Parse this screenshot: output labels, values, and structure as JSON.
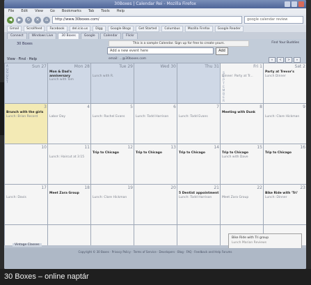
{
  "window": {
    "title": "30Boxes | Calendar Rei - Mozilla Firefox"
  },
  "menubar": [
    "File",
    "Edit",
    "View",
    "Go",
    "Bookmarks",
    "Tab",
    "Tools",
    "Help"
  ],
  "navbar": {
    "url": "http://www.30boxes.com/",
    "search_placeholder": "google calendar review"
  },
  "bookmarks": [
    "Gmail",
    "Scrollfeed",
    "Facebook",
    "del.icio.us",
    "Digg",
    "Google Blogs",
    "Get Started",
    "Columbus",
    "Mozilla Firefox",
    "Google Reader"
  ],
  "tabs": [
    "Connect",
    "Windows Live",
    "30 Boxes",
    "Google",
    "Calendar",
    "Flickr"
  ],
  "app": {
    "brand": "30 Boxes",
    "notice": "This is a sample Calendar. Sign up for free to create yours.",
    "top_links": "Find Your Buddies",
    "add_placeholder": "Add a new event here",
    "add_button": "Add",
    "view_menus": "View · Find · Help",
    "email_line": "email: ...@30boxes.com",
    "nav_arrows": [
      "«",
      "<",
      ">",
      "»"
    ]
  },
  "calendar": {
    "month_label": "SEPTEMBER",
    "sidebar_label": "AUGUST",
    "rows": [
      [
        {
          "day": "Sun 27",
          "ev": "",
          "sub": "",
          "type": "prev"
        },
        {
          "day": "Mon 28",
          "ev": "Mon & Dad's anniversary",
          "sub": "Lunch with Tom",
          "type": "prev"
        },
        {
          "day": "Tue 29",
          "ev": "",
          "sub": "Lunch with R.",
          "type": "prev"
        },
        {
          "day": "Wed 30",
          "ev": "",
          "sub": "",
          "type": "prev"
        },
        {
          "day": "Thu 31",
          "ev": "",
          "sub": "",
          "type": "prev"
        },
        {
          "day": "Fri 1",
          "ev": "",
          "sub": "Dinner: Party at Tr...",
          "type": "cur"
        },
        {
          "day": "Sat 2",
          "ev": "Party at Trevor's",
          "sub": "Lunch Dinner",
          "type": "cur"
        }
      ],
      [
        {
          "day": "3",
          "ev": "Brunch with the girls",
          "sub": "Lunch: Brian Record",
          "type": "today"
        },
        {
          "day": "4",
          "ev": "",
          "sub": "Labor Day",
          "type": "cur"
        },
        {
          "day": "5",
          "ev": "",
          "sub": "Lunch: Rachel Evans",
          "type": "cur"
        },
        {
          "day": "6",
          "ev": "",
          "sub": "Lunch: Todd Harrison",
          "type": "cur"
        },
        {
          "day": "7",
          "ev": "",
          "sub": "Lunch: Todd Evans",
          "type": "cur"
        },
        {
          "day": "8",
          "ev": "Meeting with Dunk",
          "sub": "",
          "type": "cur"
        },
        {
          "day": "9",
          "ev": "",
          "sub": "Lunch: Clare Hickman",
          "type": "cur"
        }
      ],
      [
        {
          "day": "10",
          "ev": "",
          "sub": "",
          "type": "cur"
        },
        {
          "day": "11",
          "ev": "",
          "sub": "Lunch: Haircut at 3:15",
          "type": "cur"
        },
        {
          "day": "12",
          "ev": "Trip to Chicago",
          "sub": "",
          "type": "cur"
        },
        {
          "day": "13",
          "ev": "Trip to Chicago",
          "sub": "",
          "type": "cur"
        },
        {
          "day": "14",
          "ev": "Trip to Chicago",
          "sub": "",
          "type": "cur"
        },
        {
          "day": "15",
          "ev": "Trip to Chicago",
          "sub": "Lunch with Dave",
          "type": "cur"
        },
        {
          "day": "16",
          "ev": "Trip to Chicago",
          "sub": "",
          "type": "cur"
        }
      ],
      [
        {
          "day": "17",
          "ev": "",
          "sub": "Lunch: Davis",
          "type": "cur"
        },
        {
          "day": "18",
          "ev": "Meet Zara Group",
          "sub": "",
          "type": "cur"
        },
        {
          "day": "19",
          "ev": "",
          "sub": "Lunch: Clare Hickman",
          "type": "cur"
        },
        {
          "day": "20",
          "ev": "",
          "sub": "",
          "type": "cur"
        },
        {
          "day": "21",
          "ev": "5 Dentist appointment",
          "sub": "Lunch: Todd Harrison",
          "type": "cur"
        },
        {
          "day": "22",
          "ev": "",
          "sub": "Meet Zara Group",
          "type": "cur"
        },
        {
          "day": "23",
          "ev": "Bike Ride with 'Tri'",
          "sub": "Lunch: Dinner",
          "type": "cur"
        }
      ],
      [
        {
          "day": "",
          "ev": "",
          "sub": "",
          "type": "cur"
        },
        {
          "day": "",
          "ev": "",
          "sub": "",
          "type": "cur"
        },
        {
          "day": "",
          "ev": "",
          "sub": "",
          "type": "cur"
        },
        {
          "day": "",
          "ev": "",
          "sub": "",
          "type": "cur"
        },
        {
          "day": "",
          "ev": "",
          "sub": "",
          "type": "cur"
        },
        {
          "day": "",
          "ev": "",
          "sub": "",
          "type": "cur"
        },
        {
          "day": "",
          "ev": "",
          "sub": "",
          "type": "cur"
        }
      ]
    ],
    "calendar_name": "Vintage Classes"
  },
  "popup": {
    "line1": "Bike Ride with Tri group",
    "line2": "Lunch Marian Reviews"
  },
  "footer": {
    "text": "Copyright © 30 Boxes · Privacy Policy · Terms of Service · Developers · Blog · FAQ · Feedback and Help Forums"
  },
  "caption": "30 Boxes – online naptár"
}
